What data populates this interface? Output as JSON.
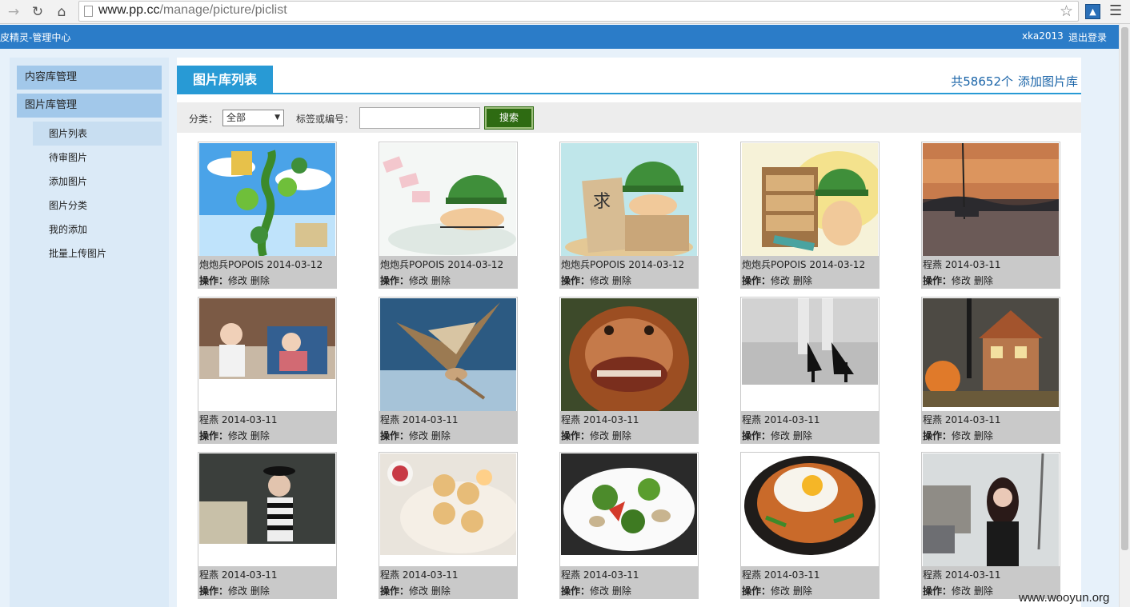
{
  "browser": {
    "url_host": "www.pp.cc",
    "url_path": "/manage/picture/piclist",
    "extension_label": "^"
  },
  "topbar": {
    "brand": "皮精灵-管理中心",
    "username": "xka2013",
    "logout": "退出登录"
  },
  "sidebar": {
    "sections": [
      {
        "label": "内容库管理"
      },
      {
        "label": "图片库管理"
      }
    ],
    "items": [
      {
        "label": "图片列表",
        "active": true
      },
      {
        "label": "待审图片"
      },
      {
        "label": "添加图片"
      },
      {
        "label": "图片分类"
      },
      {
        "label": "我的添加"
      },
      {
        "label": "批量上传图片"
      }
    ]
  },
  "main": {
    "title": "图片库列表",
    "total": "共58652个",
    "add_link": "添加图片库",
    "search": {
      "category_label": "分类：",
      "category_value": "全部",
      "tag_label": "标签或编号：",
      "tag_value": "",
      "button": "搜索"
    },
    "ops_label": "操作：",
    "edit_label": "修改",
    "delete_label": "删除",
    "pictures": [
      {
        "caption": "炮炮兵POPOIS 2014-03-12",
        "art": "cartoon-beanstalk"
      },
      {
        "caption": "炮炮兵POPOIS 2014-03-12",
        "art": "cartoon-money"
      },
      {
        "caption": "炮炮兵POPOIS 2014-03-12",
        "art": "cartoon-sign"
      },
      {
        "caption": "炮炮兵POPOIS 2014-03-12",
        "art": "cartoon-shelf"
      },
      {
        "caption": "程燕 2014-03-11",
        "art": "sunset-lake"
      },
      {
        "caption": "程燕 2014-03-11",
        "art": "kids-room"
      },
      {
        "caption": "程燕 2014-03-11",
        "art": "bird"
      },
      {
        "caption": "程燕 2014-03-11",
        "art": "orangutan"
      },
      {
        "caption": "程燕 2014-03-11",
        "art": "heels"
      },
      {
        "caption": "程燕 2014-03-11",
        "art": "gingerbread-house"
      },
      {
        "caption": "程燕 2014-03-11",
        "art": "woman-hat"
      },
      {
        "caption": "程燕 2014-03-11",
        "art": "cookies"
      },
      {
        "caption": "程燕 2014-03-11",
        "art": "vegetables"
      },
      {
        "caption": "程燕 2014-03-11",
        "art": "bibimbap"
      },
      {
        "caption": "程燕 2014-03-11",
        "art": "woman-street"
      }
    ]
  },
  "watermark": "www.wooyun.org",
  "colors": {
    "topbar": "#2b7cc8",
    "tab": "#289ad5",
    "search_button": "#2e6b12",
    "sidebar_section": "#a2c8ea"
  }
}
